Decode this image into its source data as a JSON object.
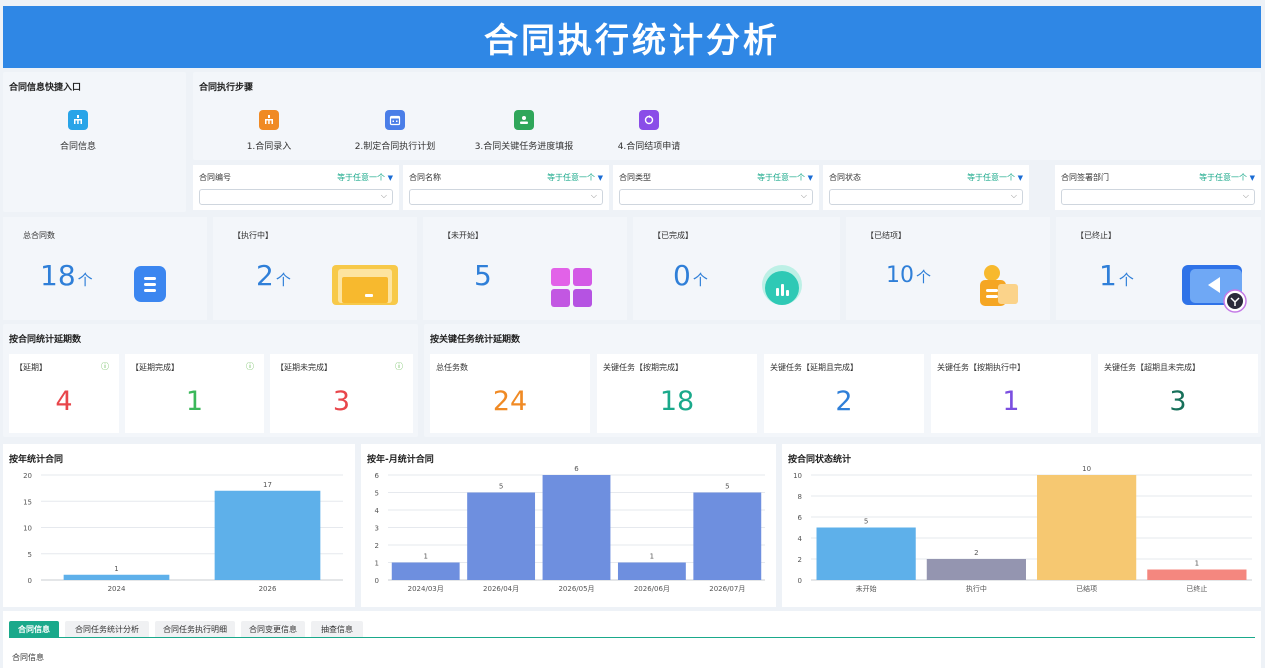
{
  "header": {
    "title": "合同执行统计分析"
  },
  "quick": {
    "title": "合同信息快捷入口",
    "item": "合同信息"
  },
  "steps": {
    "title": "合同执行步骤",
    "items": [
      "1.合同录入",
      "2.制定合同执行计划",
      "3.合同关键任务进度填报",
      "4.合同结项申请"
    ]
  },
  "filters": [
    {
      "label": "合同编号",
      "op": "等于任意一个"
    },
    {
      "label": "合同名称",
      "op": "等于任意一个"
    },
    {
      "label": "合同类型",
      "op": "等于任意一个"
    },
    {
      "label": "合同状态",
      "op": "等于任意一个"
    },
    {
      "label": "合同签署部门",
      "op": "等于任意一个"
    }
  ],
  "kpis": [
    {
      "label": "总合同数",
      "value": "18",
      "unit": "个",
      "color": "#2f7fd8"
    },
    {
      "label": "【执行中】",
      "value": "2",
      "unit": "个",
      "color": "#2f7fd8"
    },
    {
      "label": "【未开始】",
      "value": "5",
      "unit": "",
      "color": "#2f7fd8"
    },
    {
      "label": "【已完成】",
      "value": "0",
      "unit": "个",
      "color": "#2f7fd8"
    },
    {
      "label": "【已结项】",
      "value": "10",
      "unit": "个",
      "color": "#2f7fd8"
    },
    {
      "label": "【已终止】",
      "value": "1",
      "unit": "个",
      "color": "#2f7fd8"
    }
  ],
  "delay": {
    "title": "按合同统计延期数",
    "items": [
      {
        "label": "【延期】",
        "value": "4",
        "color": "#e8464b"
      },
      {
        "label": "【延期完成】",
        "value": "1",
        "color": "#3bb85a"
      },
      {
        "label": "【延期未完成】",
        "value": "3",
        "color": "#e8464b"
      }
    ]
  },
  "task": {
    "title": "按关键任务统计延期数",
    "items": [
      {
        "label": "总任务数",
        "value": "24",
        "color": "#f08a24"
      },
      {
        "label": "关键任务【按期完成】",
        "value": "18",
        "color": "#1aa98b"
      },
      {
        "label": "关键任务【延期且完成】",
        "value": "2",
        "color": "#2f7fd8"
      },
      {
        "label": "关键任务【按期执行中】",
        "value": "1",
        "color": "#7b4fe0"
      },
      {
        "label": "关键任务【超期且未完成】",
        "value": "3",
        "color": "#17705a"
      }
    ]
  },
  "chart_data": [
    {
      "type": "bar",
      "title": "按年统计合同",
      "categories": [
        "2024",
        "2026"
      ],
      "values": [
        1,
        17
      ],
      "ylim": [
        0,
        20
      ],
      "yticks": [
        0,
        5,
        10,
        15,
        20
      ],
      "colors": [
        "#5eb0ea",
        "#5eb0ea"
      ]
    },
    {
      "type": "bar",
      "title": "按年-月统计合同",
      "categories": [
        "2024/03月",
        "2026/04月",
        "2026/05月",
        "2026/06月",
        "2026/07月"
      ],
      "values": [
        1,
        5,
        6,
        1,
        5
      ],
      "ylim": [
        0,
        6
      ],
      "yticks": [
        0,
        1,
        2,
        3,
        4,
        5,
        6
      ],
      "colors": [
        "#6e8fdf",
        "#6e8fdf",
        "#6e8fdf",
        "#6e8fdf",
        "#6e8fdf"
      ]
    },
    {
      "type": "bar",
      "title": "按合同状态统计",
      "categories": [
        "未开始",
        "执行中",
        "已结项",
        "已终止"
      ],
      "values": [
        5,
        2,
        10,
        1
      ],
      "ylim": [
        0,
        10
      ],
      "yticks": [
        0,
        2,
        4,
        6,
        8,
        10
      ],
      "colors": [
        "#5eb0ea",
        "#9495b0",
        "#f6c871",
        "#f4877f"
      ]
    }
  ],
  "tabs": {
    "items": [
      "合同信息",
      "合同任务统计分析",
      "合同任务执行明细",
      "合同变更信息",
      "抽查信息"
    ],
    "active": 0,
    "content": "合同信息"
  }
}
